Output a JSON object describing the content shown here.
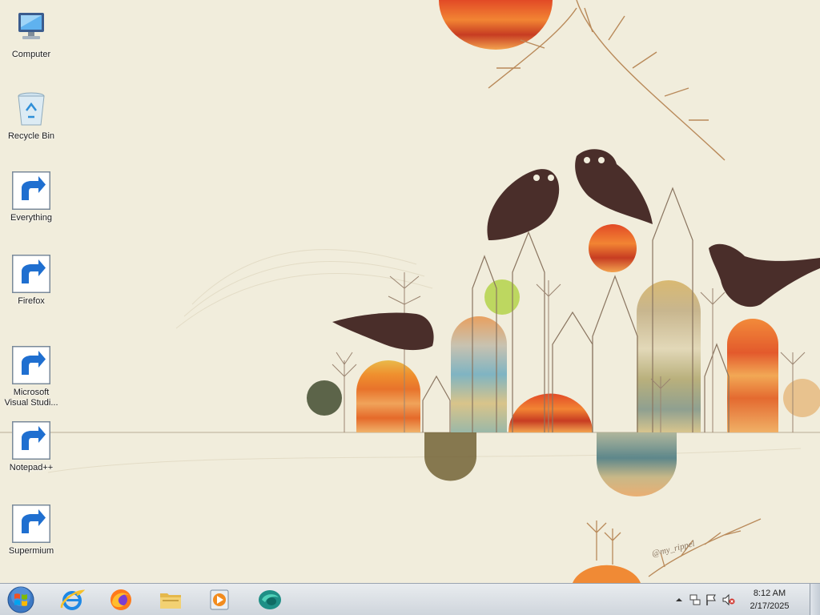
{
  "desktop_icons": [
    {
      "label": "Computer",
      "icon": "computer-icon",
      "shortcut": false
    },
    {
      "label": "Recycle Bin",
      "icon": "recycle-bin-icon",
      "shortcut": false
    },
    {
      "label": "Everything",
      "icon": "everything-search-icon",
      "shortcut": true
    },
    {
      "label": "Firefox",
      "icon": "firefox-icon",
      "shortcut": true
    },
    {
      "label": "Microsoft Visual Studi...",
      "icon": "visual-studio-icon",
      "shortcut": true
    },
    {
      "label": "Notepad++",
      "icon": "notepad-plus-plus-icon",
      "shortcut": true
    },
    {
      "label": "Supermium",
      "icon": "supermium-icon",
      "shortcut": true
    }
  ],
  "taskbar": {
    "start": "windows-start-orb-icon",
    "pinned": [
      "internet-explorer-icon",
      "firefox-icon",
      "file-explorer-icon",
      "media-player-icon",
      "supermium-icon"
    ]
  },
  "tray": {
    "icons": [
      "show-hidden-icons-chevron",
      "network-icon",
      "action-center-flag-icon",
      "volume-muted-icon"
    ],
    "time": "8:12 AM",
    "date": "2/17/2025"
  },
  "colors": {
    "desktop_bg": "#f1eddc",
    "taskbar": "#d9dee4",
    "text": "#1b1b1b"
  }
}
